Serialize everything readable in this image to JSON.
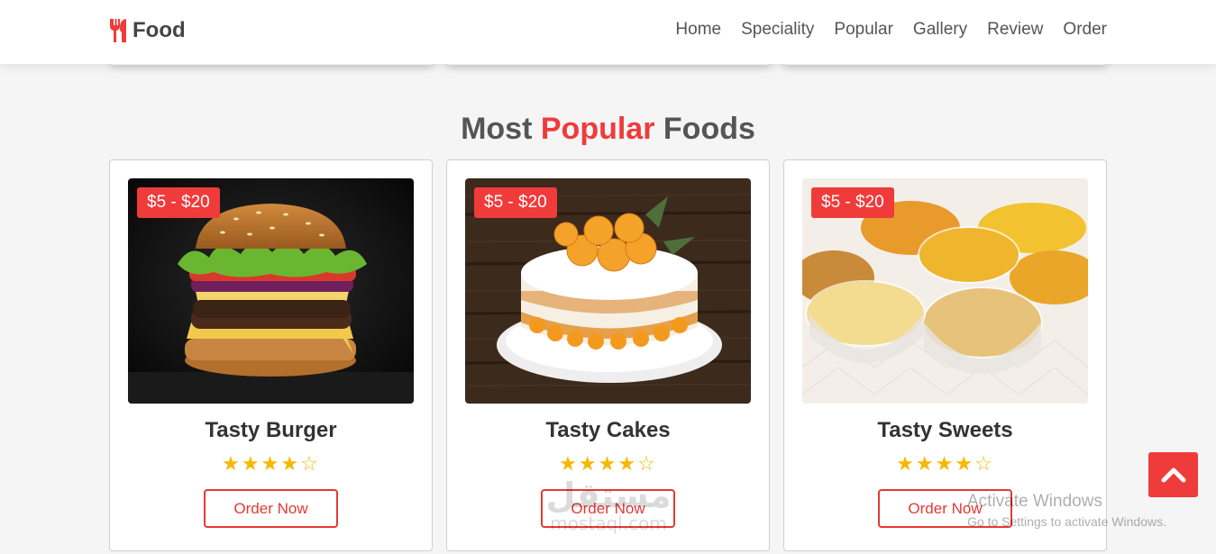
{
  "header": {
    "logo_text": "Food",
    "nav": [
      "Home",
      "Speciality",
      "Popular",
      "Gallery",
      "Review",
      "Order"
    ]
  },
  "section": {
    "title_before": "Most",
    "title_accent": "Popular",
    "title_after": "Foods"
  },
  "cards": [
    {
      "price": "$5 - $20",
      "title": "Tasty Burger",
      "rating": 4,
      "max_rating": 5,
      "button": "Order Now",
      "image": "burger-image"
    },
    {
      "price": "$5 - $20",
      "title": "Tasty Cakes",
      "rating": 4,
      "max_rating": 5,
      "button": "Order Now",
      "image": "cake-image"
    },
    {
      "price": "$5 - $20",
      "title": "Tasty Sweets",
      "rating": 4,
      "max_rating": 5,
      "button": "Order Now",
      "image": "sweets-image"
    }
  ],
  "watermark": {
    "arabic": "مستقل",
    "latin": "mostaql.com"
  },
  "os_overlay": {
    "line1": "Activate Windows",
    "line2": "Go to Settings to activate Windows."
  },
  "colors": {
    "accent": "#f03b3b",
    "star": "#f6b800",
    "background": "#f5f5f5"
  },
  "icons": {
    "logo": "utensils-icon",
    "scroll_top": "chevron-up-icon",
    "star_filled": "star-icon",
    "star_empty": "star-outline-icon"
  }
}
